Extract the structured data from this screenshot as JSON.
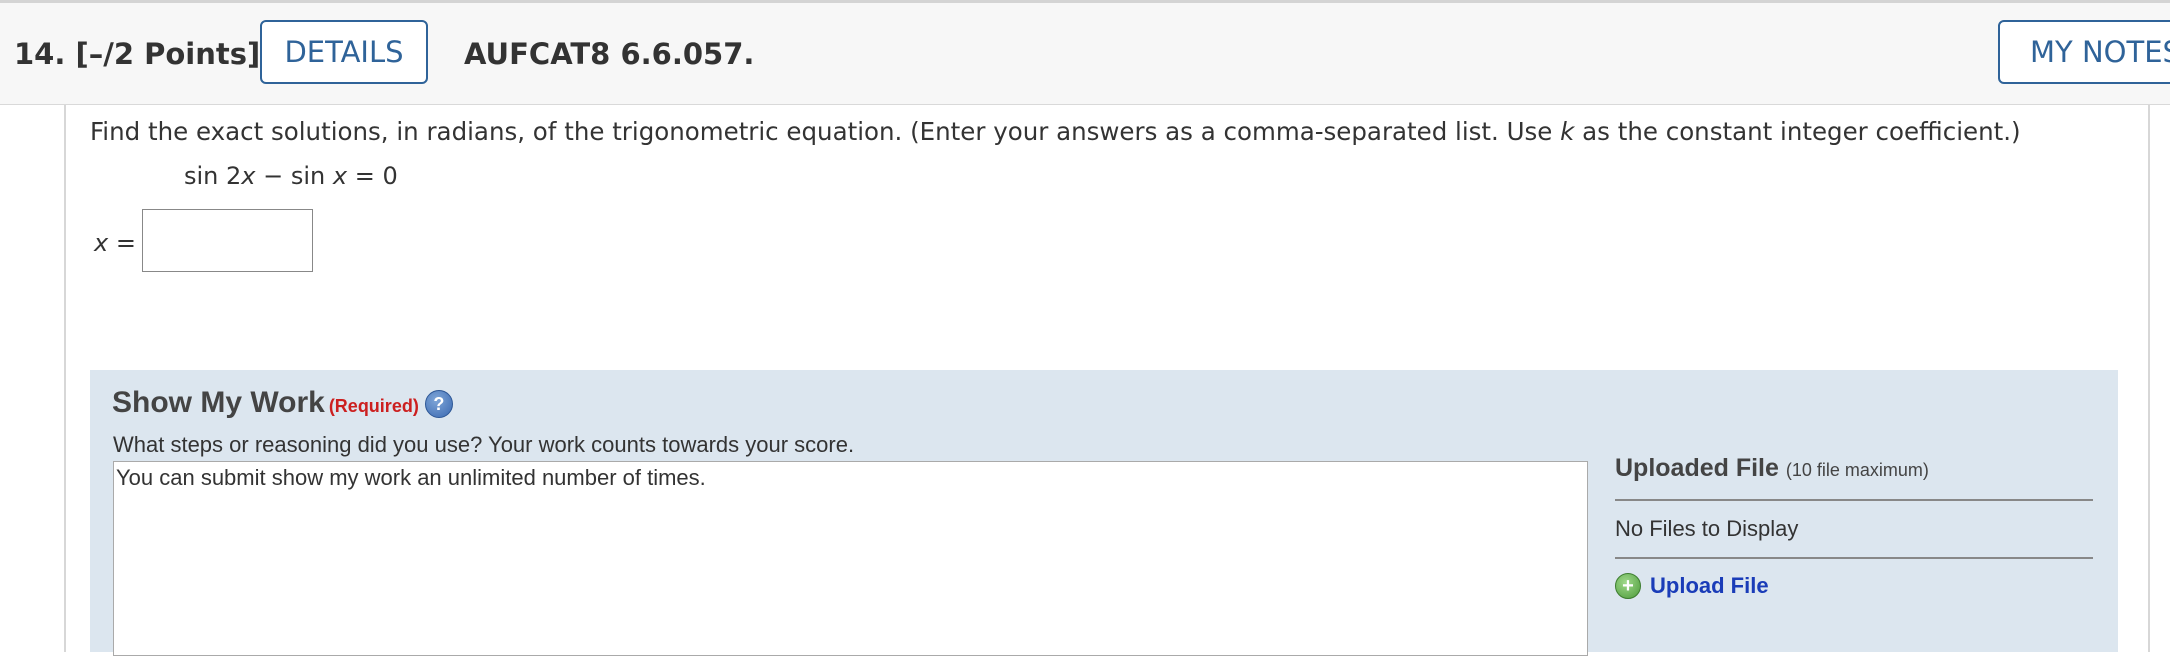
{
  "header": {
    "question_number": "14.  [–/2 Points]",
    "details_label": "DETAILS",
    "problem_code": "AUFCAT8 6.6.057.",
    "my_notes_label": "MY NOTES"
  },
  "question": {
    "prompt_before_k": "Find the exact solutions, in radians, of the trigonometric equation. (Enter your answers as a comma-separated list. Use ",
    "k_variable": "k",
    "prompt_after_k": " as the constant integer coefficient.)",
    "equation_part1": "sin 2",
    "equation_x1": "x",
    "equation_part2": " − sin ",
    "equation_x2": "x",
    "equation_part3": " = 0",
    "answer_label_var": "x",
    "answer_label_eq": " =",
    "answer_value": ""
  },
  "show_my_work": {
    "title": "Show My Work",
    "required": "(Required)",
    "help_icon": "help-icon",
    "question": "What steps or reasoning did you use? Your work counts towards your score.",
    "work_text": "You can submit show my work an unlimited number of times.",
    "uploaded_title": "Uploaded File",
    "uploaded_note": "(10 file maximum)",
    "no_files": "No Files to Display",
    "upload_label": "Upload File",
    "upload_icon": "plus-circle-icon"
  },
  "colors": {
    "accent_blue": "#2f6399",
    "panel_bg": "#dce6ef",
    "required_red": "#cc1f1f",
    "link_blue": "#1a3cb8"
  }
}
